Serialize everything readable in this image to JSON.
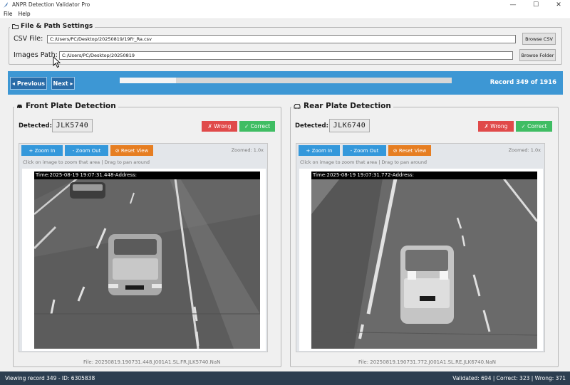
{
  "window": {
    "title": "ANPR Detection Validator Pro",
    "minimize": "—",
    "maximize": "☐",
    "close": "✕"
  },
  "menu": [
    "File",
    "Help"
  ],
  "settings": {
    "title": "File & Path Settings",
    "csv_label": "CSV File:",
    "csv_value": "C:/Users/PC/Desktop/20250819/19Fr_Ra.csv",
    "browse_csv": "Browse CSV",
    "images_label": "Images Path:",
    "images_value": "C:/Users/PC/Desktop/20250819",
    "browse_folder": "Browse Folder"
  },
  "nav": {
    "previous": "◂ Previous",
    "next": "Next ▸",
    "progress": 0.17,
    "record": "Record 349 of 1916"
  },
  "front": {
    "title": "Front Plate Detection",
    "detected_label": "Detected:",
    "plate": "JLK5740",
    "wrong": "✗ Wrong",
    "correct": "✓ Correct",
    "zoom_in": "+ Zoom In",
    "zoom_out": "- Zoom Out",
    "reset_view": "⊘ Reset View",
    "zoomed": "Zoomed: 1.0x",
    "hint": "Click on image to zoom that area | Drag to pan around",
    "overlay": "Time:2025-08-19 19:07:31.448-Address:",
    "file": "File: 20250819.190731.448.J001A1.SL.FR.JLK5740.NaN"
  },
  "rear": {
    "title": "Rear Plate Detection",
    "detected_label": "Detected:",
    "plate": "JLK6740",
    "wrong": "✗ Wrong",
    "correct": "✓ Correct",
    "zoom_in": "+ Zoom In",
    "zoom_out": "- Zoom Out",
    "reset_view": "⊘ Reset View",
    "zoomed": "Zoomed: 1.0x",
    "hint": "Click on image to zoom that area | Drag to pan around",
    "overlay": "Time:2025-08-19 19:07:31.772-Address:",
    "file": "File: 20250819.190731.772.J001A1.SL.RE.JLK6740.NaN"
  },
  "status": {
    "left": "Viewing record 349 - ID: 6305838",
    "right": "Validated: 694 | Correct: 323 | Wrong: 371"
  },
  "colors": {
    "nav_bar": "#3d97d4",
    "wrong": "#e04a4a",
    "correct": "#3fbd63",
    "zoom": "#3498db",
    "reset": "#e67e22",
    "statusbar": "#2c3e50"
  }
}
